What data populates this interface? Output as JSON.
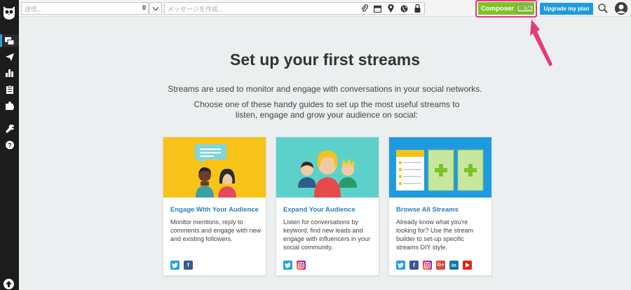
{
  "topbar": {
    "sendto_placeholder": "送信...",
    "sendto_count": "0",
    "compose_placeholder": "メッセージを作成...",
    "composer_label": "Composer",
    "composer_badge": "BETA",
    "upgrade_label": "Upgrade my plan"
  },
  "main": {
    "title": "Set up your first streams",
    "description": "Streams are used to monitor and engage with conversations in your social networks.",
    "instruction": "Choose one of these handy guides to set up the most useful streams to listen, engage and grow your audience on social:"
  },
  "cards": [
    {
      "title": "Engage With Your Audience",
      "text": "Monitor mentions, reply to comments and engage with new and existing followers.",
      "bg": "#f7c318",
      "networks": [
        "twitter-icon",
        "facebook-icon"
      ]
    },
    {
      "title": "Expand Your Audience",
      "text": "Listen for conversations by keyword, find new leads and engage with influencers in your social community.",
      "bg": "#5cd1c9",
      "networks": [
        "twitter-icon",
        "instagram-icon"
      ]
    },
    {
      "title": "Browse All Streams",
      "text": "Already know what you're looking for? Use the stream builder to set-up specific streams DIY style.",
      "bg": "#1e9be0",
      "networks": [
        "twitter-icon",
        "facebook-icon",
        "instagram-icon",
        "google-plus-icon",
        "linkedin-icon",
        "youtube-icon"
      ]
    }
  ],
  "colors": {
    "accent_pink": "#e63a7a",
    "composer_green": "#7fc12a",
    "upgrade_blue": "#1e9be0",
    "link_blue": "#2d7dbb"
  }
}
